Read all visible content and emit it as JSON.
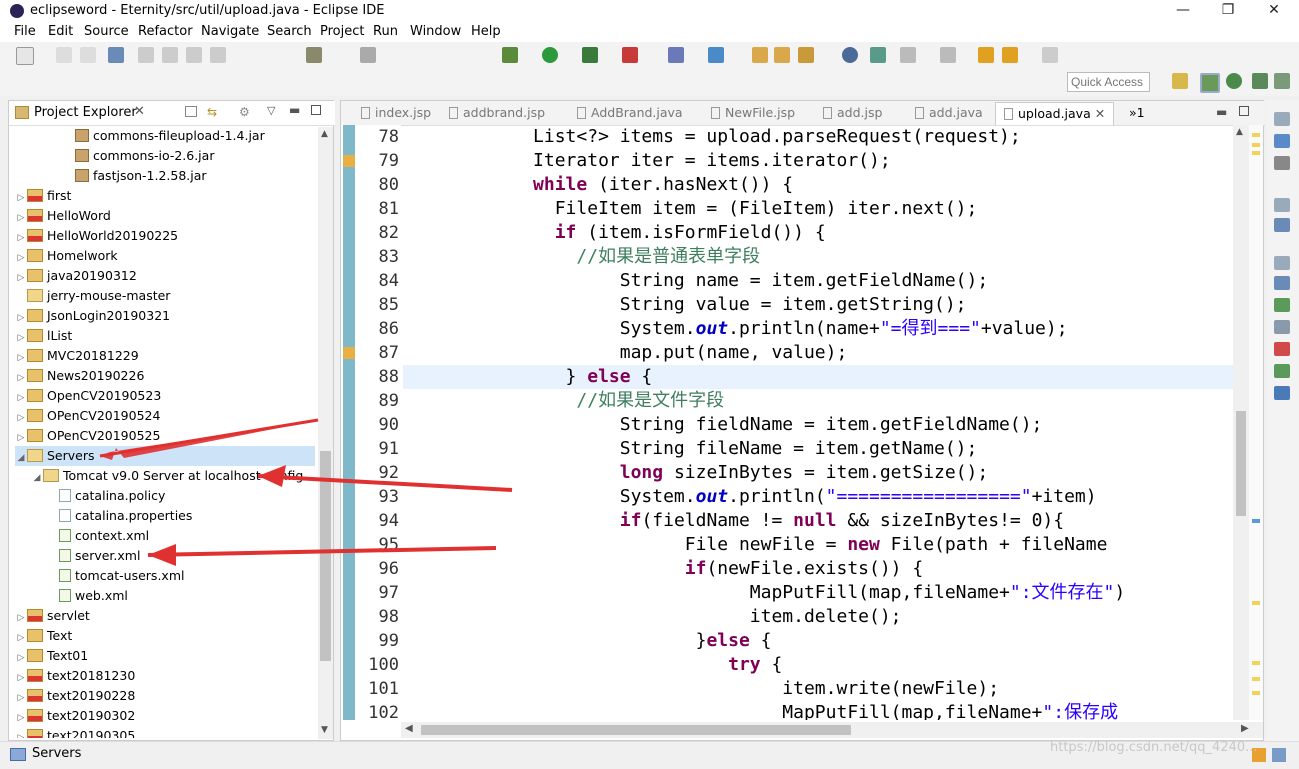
{
  "window": {
    "title": "eclipseword - Eternity/src/util/upload.java - Eclipse IDE",
    "minimize": "—",
    "maximize": "❐",
    "close": "✕"
  },
  "menu": [
    "File",
    "Edit",
    "Source",
    "Refactor",
    "Navigate",
    "Search",
    "Project",
    "Run",
    "Window",
    "Help"
  ],
  "quick_access": {
    "placeholder": "Quick Access"
  },
  "explorer": {
    "title": "Project Explorer",
    "items": [
      {
        "label": "commons-fileupload-1.4.jar",
        "indent": 3,
        "type": "jar",
        "expander": ""
      },
      {
        "label": "commons-io-2.6.jar",
        "indent": 3,
        "type": "jar",
        "expander": ""
      },
      {
        "label": "fastjson-1.2.58.jar",
        "indent": 3,
        "type": "jar",
        "expander": ""
      },
      {
        "label": "first",
        "indent": 0,
        "type": "projerr",
        "expander": "▷"
      },
      {
        "label": "HelloWord",
        "indent": 0,
        "type": "projerr",
        "expander": "▷"
      },
      {
        "label": "HelloWorld20190225",
        "indent": 0,
        "type": "projerr",
        "expander": "▷"
      },
      {
        "label": "Homelwork",
        "indent": 0,
        "type": "proj",
        "expander": "▷"
      },
      {
        "label": "java20190312",
        "indent": 0,
        "type": "proj",
        "expander": "▷"
      },
      {
        "label": "jerry-mouse-master",
        "indent": 0,
        "type": "folder",
        "expander": ""
      },
      {
        "label": "JsonLogin20190321",
        "indent": 0,
        "type": "proj",
        "expander": "▷"
      },
      {
        "label": "lList",
        "indent": 0,
        "type": "proj",
        "expander": "▷"
      },
      {
        "label": "MVC20181229",
        "indent": 0,
        "type": "proj",
        "expander": "▷"
      },
      {
        "label": "News20190226",
        "indent": 0,
        "type": "proj",
        "expander": "▷"
      },
      {
        "label": "OpenCV20190523",
        "indent": 0,
        "type": "proj",
        "expander": "▷"
      },
      {
        "label": "OPenCV20190524",
        "indent": 0,
        "type": "proj",
        "expander": "▷"
      },
      {
        "label": "OPenCV20190525",
        "indent": 0,
        "type": "proj",
        "expander": "▷"
      },
      {
        "label": "Servers",
        "indent": 0,
        "type": "folder",
        "expander": "◢",
        "selected": true
      },
      {
        "label": "Tomcat v9.0 Server at localhost-config",
        "indent": 1,
        "type": "folder",
        "expander": "◢"
      },
      {
        "label": "catalina.policy",
        "indent": 2,
        "type": "file",
        "expander": ""
      },
      {
        "label": "catalina.properties",
        "indent": 2,
        "type": "file",
        "expander": ""
      },
      {
        "label": "context.xml",
        "indent": 2,
        "type": "xml",
        "expander": ""
      },
      {
        "label": "server.xml",
        "indent": 2,
        "type": "xml",
        "expander": ""
      },
      {
        "label": "tomcat-users.xml",
        "indent": 2,
        "type": "xml",
        "expander": ""
      },
      {
        "label": "web.xml",
        "indent": 2,
        "type": "xml",
        "expander": ""
      },
      {
        "label": "servlet",
        "indent": 0,
        "type": "projerr",
        "expander": "▷"
      },
      {
        "label": "Text",
        "indent": 0,
        "type": "proj",
        "expander": "▷"
      },
      {
        "label": "Text01",
        "indent": 0,
        "type": "proj",
        "expander": "▷"
      },
      {
        "label": "text20181230",
        "indent": 0,
        "type": "projerr",
        "expander": "▷"
      },
      {
        "label": "text20190228",
        "indent": 0,
        "type": "projerr",
        "expander": "▷"
      },
      {
        "label": "text20190302",
        "indent": 0,
        "type": "projerr",
        "expander": "▷"
      },
      {
        "label": "text20190305",
        "indent": 0,
        "type": "projerr",
        "expander": "▷"
      }
    ]
  },
  "editor": {
    "tabs": [
      {
        "label": "index.jsp"
      },
      {
        "label": "addbrand.jsp"
      },
      {
        "label": "AddBrand.java"
      },
      {
        "label": "NewFile.jsp"
      },
      {
        "label": "add.jsp"
      },
      {
        "label": "add.java"
      },
      {
        "label": "upload.java",
        "active": true
      }
    ],
    "overflow": "»1",
    "lines": [
      {
        "n": "78",
        "code": "            List<?> items = upload.parseRequest(request);"
      },
      {
        "n": "79",
        "code": "            Iterator iter = items.iterator();"
      },
      {
        "n": "80",
        "code": "            while (iter.hasNext()) {"
      },
      {
        "n": "81",
        "code": "              FileItem item = (FileItem) iter.next();"
      },
      {
        "n": "82",
        "code": "              if (item.isFormField()) {"
      },
      {
        "n": "83",
        "code": "                //如果是普通表单字段"
      },
      {
        "n": "84",
        "code": "                    String name = item.getFieldName();"
      },
      {
        "n": "85",
        "code": "                    String value = item.getString();"
      },
      {
        "n": "86",
        "code": "                    System.out.println(name+\"=得到===\"+value);"
      },
      {
        "n": "87",
        "code": "                    map.put(name, value);"
      },
      {
        "n": "88",
        "code": "               } else {"
      },
      {
        "n": "89",
        "code": "                //如果是文件字段"
      },
      {
        "n": "90",
        "code": "                    String fieldName = item.getFieldName();"
      },
      {
        "n": "91",
        "code": "                    String fileName = item.getName();"
      },
      {
        "n": "92",
        "code": "                    long sizeInBytes = item.getSize();"
      },
      {
        "n": "93",
        "code": "                    System.out.println(\"=================\"+item)"
      },
      {
        "n": "94",
        "code": "                    if(fieldName != null && sizeInBytes!= 0){"
      },
      {
        "n": "95",
        "code": "                          File newFile = new File(path + fileName"
      },
      {
        "n": "96",
        "code": "                          if(newFile.exists()) {"
      },
      {
        "n": "97",
        "code": "                                MapPutFill(map,fileName+\":文件存在\")"
      },
      {
        "n": "98",
        "code": "                                item.delete();"
      },
      {
        "n": "99",
        "code": "                           }else {"
      },
      {
        "n": "100",
        "code": "                              try {"
      },
      {
        "n": "101",
        "code": "                                   item.write(newFile);"
      },
      {
        "n": "102",
        "code": "                                   MapPutFill(map,fileName+\":保存成"
      }
    ]
  },
  "status": {
    "text": "Servers"
  },
  "watermark": "https://blog.csdn.net/qq_4240..."
}
